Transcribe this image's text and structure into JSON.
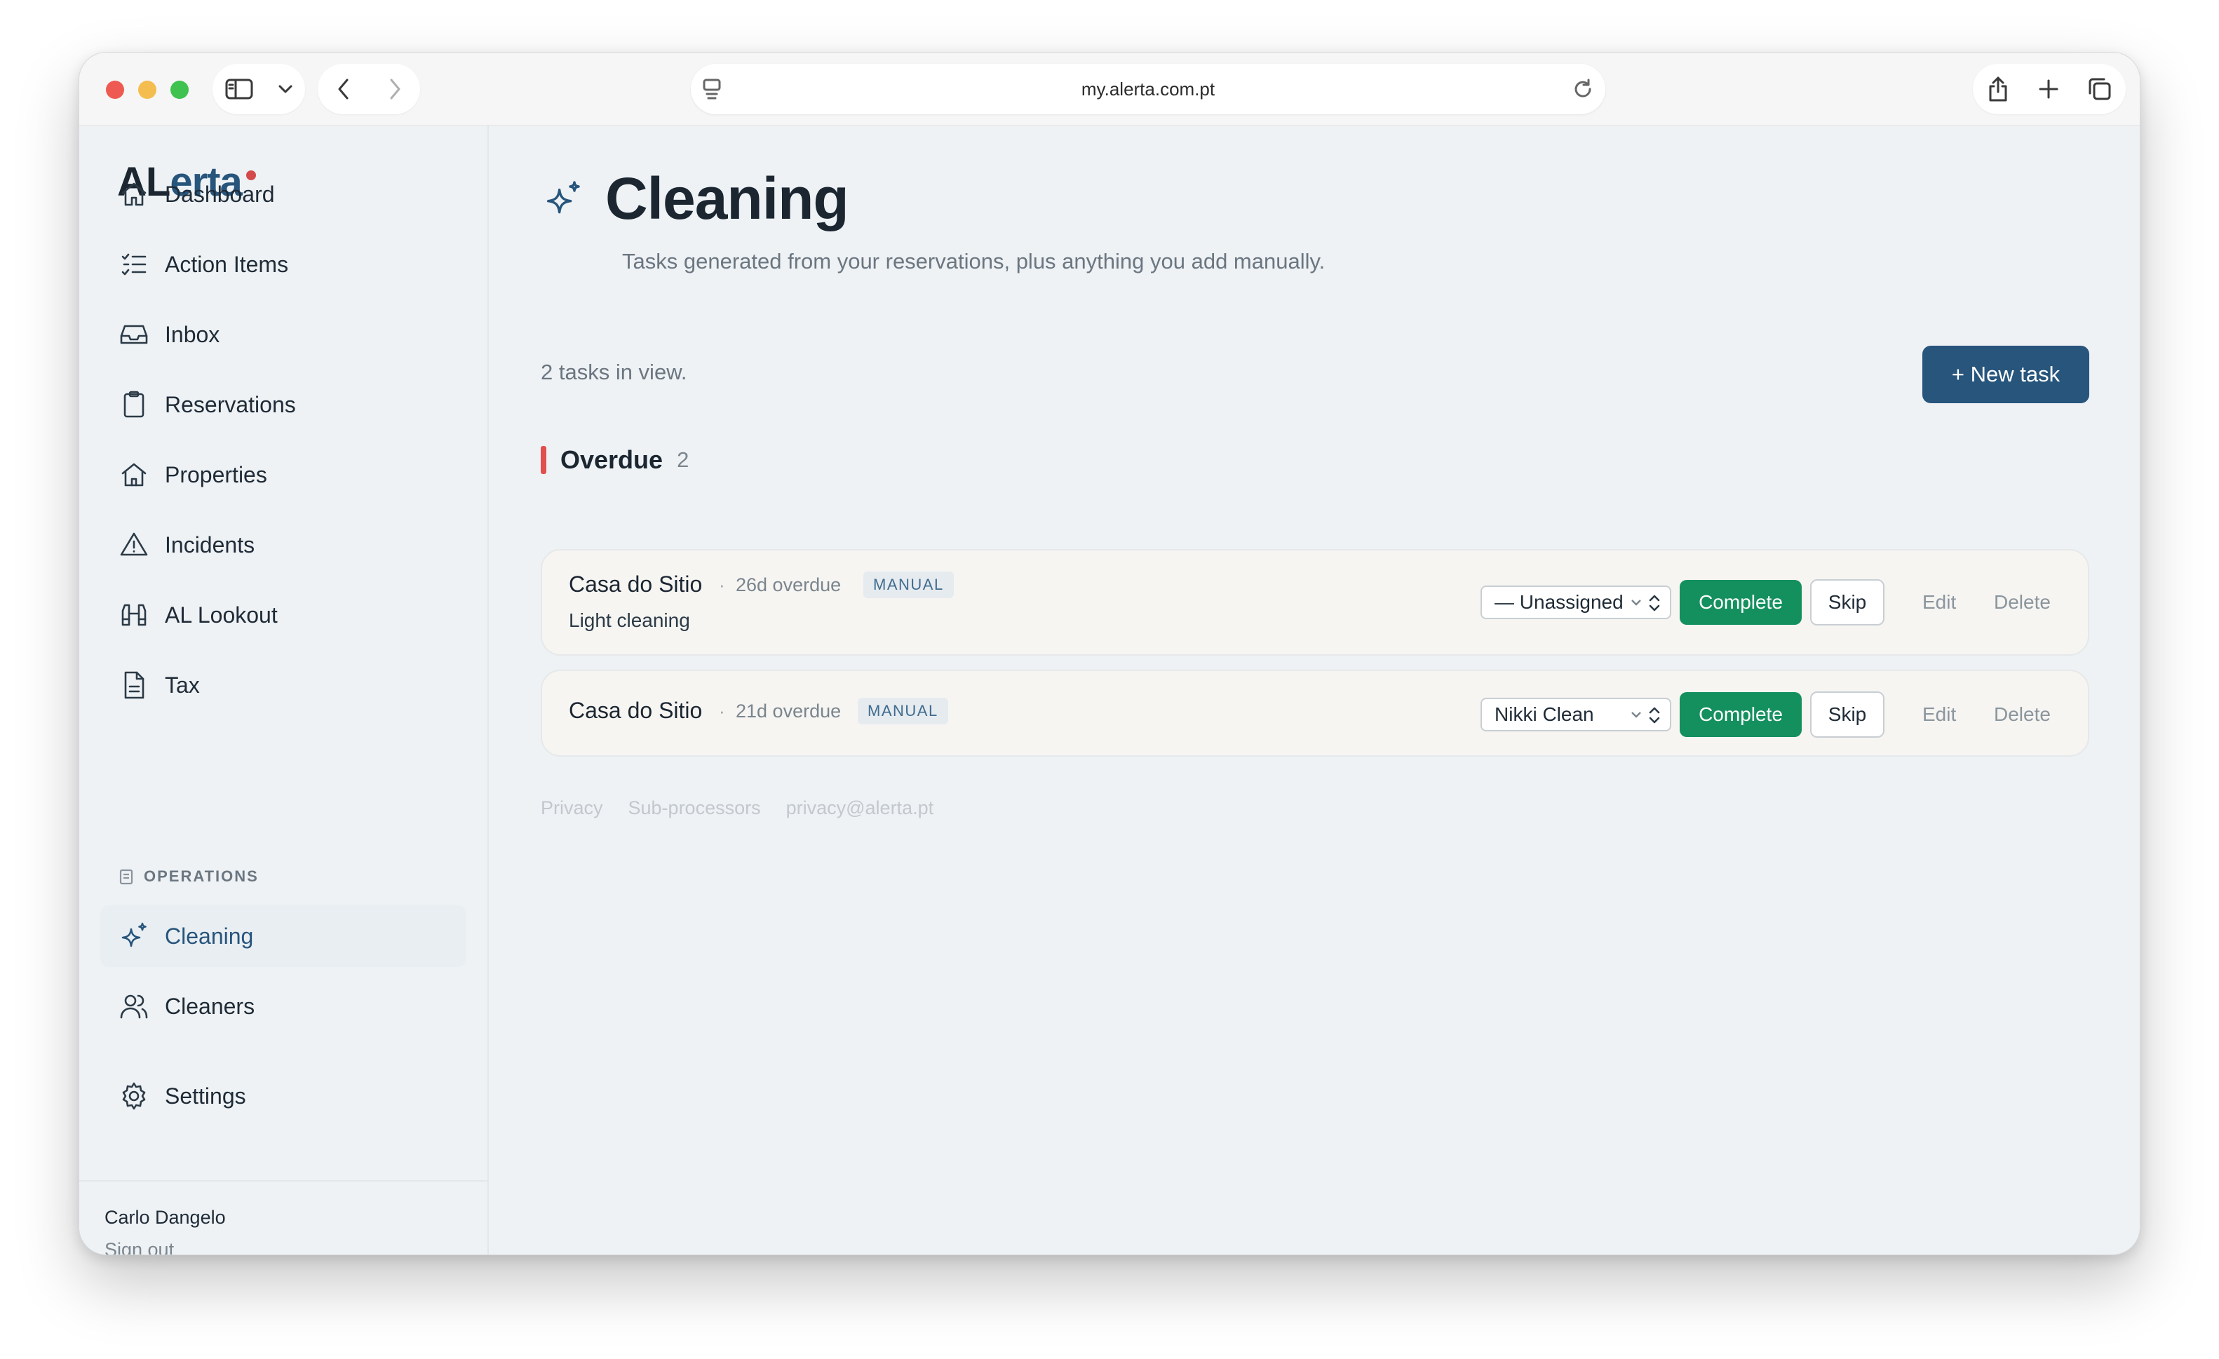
{
  "browser": {
    "url": "my.alerta.com.pt"
  },
  "brand": {
    "logo_prefix": "AL",
    "logo_suffix": "erta",
    "accent": "#27557c",
    "dot_color": "#d34a4a"
  },
  "sidebar": {
    "items": [
      {
        "label": "Dashboard",
        "icon": "home-icon"
      },
      {
        "label": "Action Items",
        "icon": "checklist-icon"
      },
      {
        "label": "Inbox",
        "icon": "inbox-icon"
      },
      {
        "label": "Reservations",
        "icon": "clipboard-icon"
      },
      {
        "label": "Properties",
        "icon": "house-icon"
      },
      {
        "label": "Incidents",
        "icon": "warning-icon"
      },
      {
        "label": "AL Lookout",
        "icon": "binoculars-icon"
      },
      {
        "label": "Tax",
        "icon": "document-icon"
      }
    ],
    "section_label": "OPERATIONS",
    "ops_items": [
      {
        "label": "Cleaning",
        "icon": "sparkles-icon",
        "active": true
      },
      {
        "label": "Cleaners",
        "icon": "users-icon"
      }
    ],
    "settings_label": "Settings",
    "user_name": "Carlo Dangelo",
    "sign_out": "Sign out"
  },
  "page": {
    "title": "Cleaning",
    "subtitle": "Tasks generated from your reservations, plus anything you add manually.",
    "count_text": "2 tasks in view.",
    "new_task_label": "+ New task"
  },
  "group": {
    "title": "Overdue",
    "count": "2",
    "color": "#e0504c"
  },
  "tasks": [
    {
      "property": "Casa do Sitio",
      "separator": "·",
      "overdue": "26d overdue",
      "badge": "MANUAL",
      "description": "Light cleaning",
      "assignee": "— Unassigned",
      "complete_label": "Complete",
      "skip_label": "Skip",
      "edit_label": "Edit",
      "delete_label": "Delete"
    },
    {
      "property": "Casa do Sitio",
      "separator": "·",
      "overdue": "21d overdue",
      "badge": "MANUAL",
      "description": "",
      "assignee": "Nikki Clean",
      "complete_label": "Complete",
      "skip_label": "Skip",
      "edit_label": "Edit",
      "delete_label": "Delete"
    }
  ],
  "footer": {
    "links": [
      "Privacy",
      "Sub-processors",
      "privacy@alerta.pt"
    ]
  }
}
